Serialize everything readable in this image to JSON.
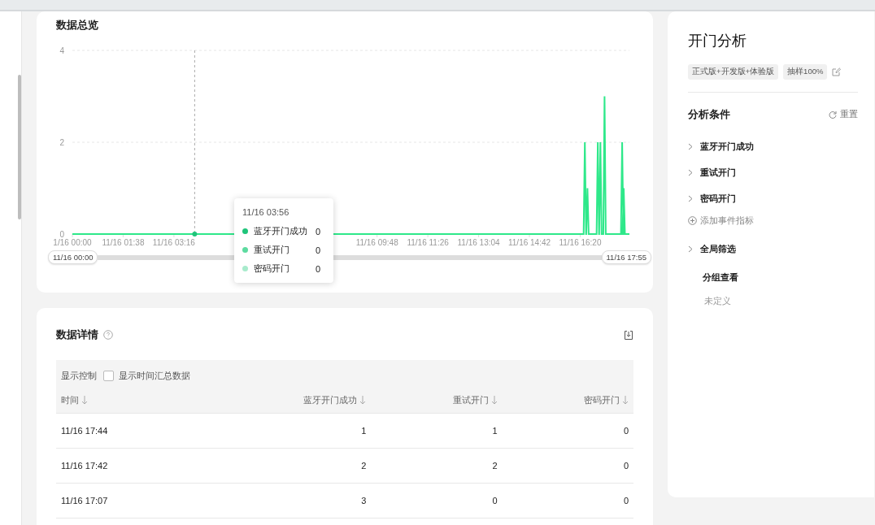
{
  "overview": {
    "title": "数据总览",
    "y_axis": [
      "4",
      "2",
      "0"
    ],
    "x_axis": [
      "1/16 00:00",
      "11/16 01:38",
      "11/16 03:16",
      "11/16 09:48",
      "11/16 11:26",
      "11/16 13:04",
      "11/16 14:42",
      "11/16 16:20"
    ],
    "series": [
      {
        "name": "蓝牙开门成功",
        "color": "#1fc47a"
      },
      {
        "name": "重试开门",
        "color": "#5ddba0"
      },
      {
        "name": "密码开门",
        "color": "#a8ebcc"
      }
    ],
    "hover": {
      "title": "11/16 03:56",
      "values": [
        "0",
        "0",
        "0"
      ]
    },
    "range": {
      "start": "11/16 00:00",
      "end": "11/16 17:55"
    }
  },
  "details": {
    "title": "数据详情",
    "display_control": "显示控制",
    "summary_option": {
      "label": "显示时间汇总数据",
      "checked": false
    },
    "columns": [
      "时间",
      "蓝牙开门成功",
      "重试开门",
      "密码开门"
    ],
    "rows": [
      [
        "11/16 17:44",
        "1",
        "1",
        "0"
      ],
      [
        "11/16 17:42",
        "2",
        "2",
        "0"
      ],
      [
        "11/16 17:07",
        "3",
        "0",
        "0"
      ]
    ]
  },
  "panel": {
    "title": "开门分析",
    "tags": [
      "正式版+开发版+体验版",
      "抽样100%"
    ],
    "conditions_title": "分析条件",
    "reset": "重置",
    "events": [
      "蓝牙开门成功",
      "重试开门",
      "密码开门"
    ],
    "add_metric": "添加事件指标",
    "global_filter": "全局筛选",
    "group": {
      "title": "分组查看",
      "value": "未定义"
    }
  }
}
